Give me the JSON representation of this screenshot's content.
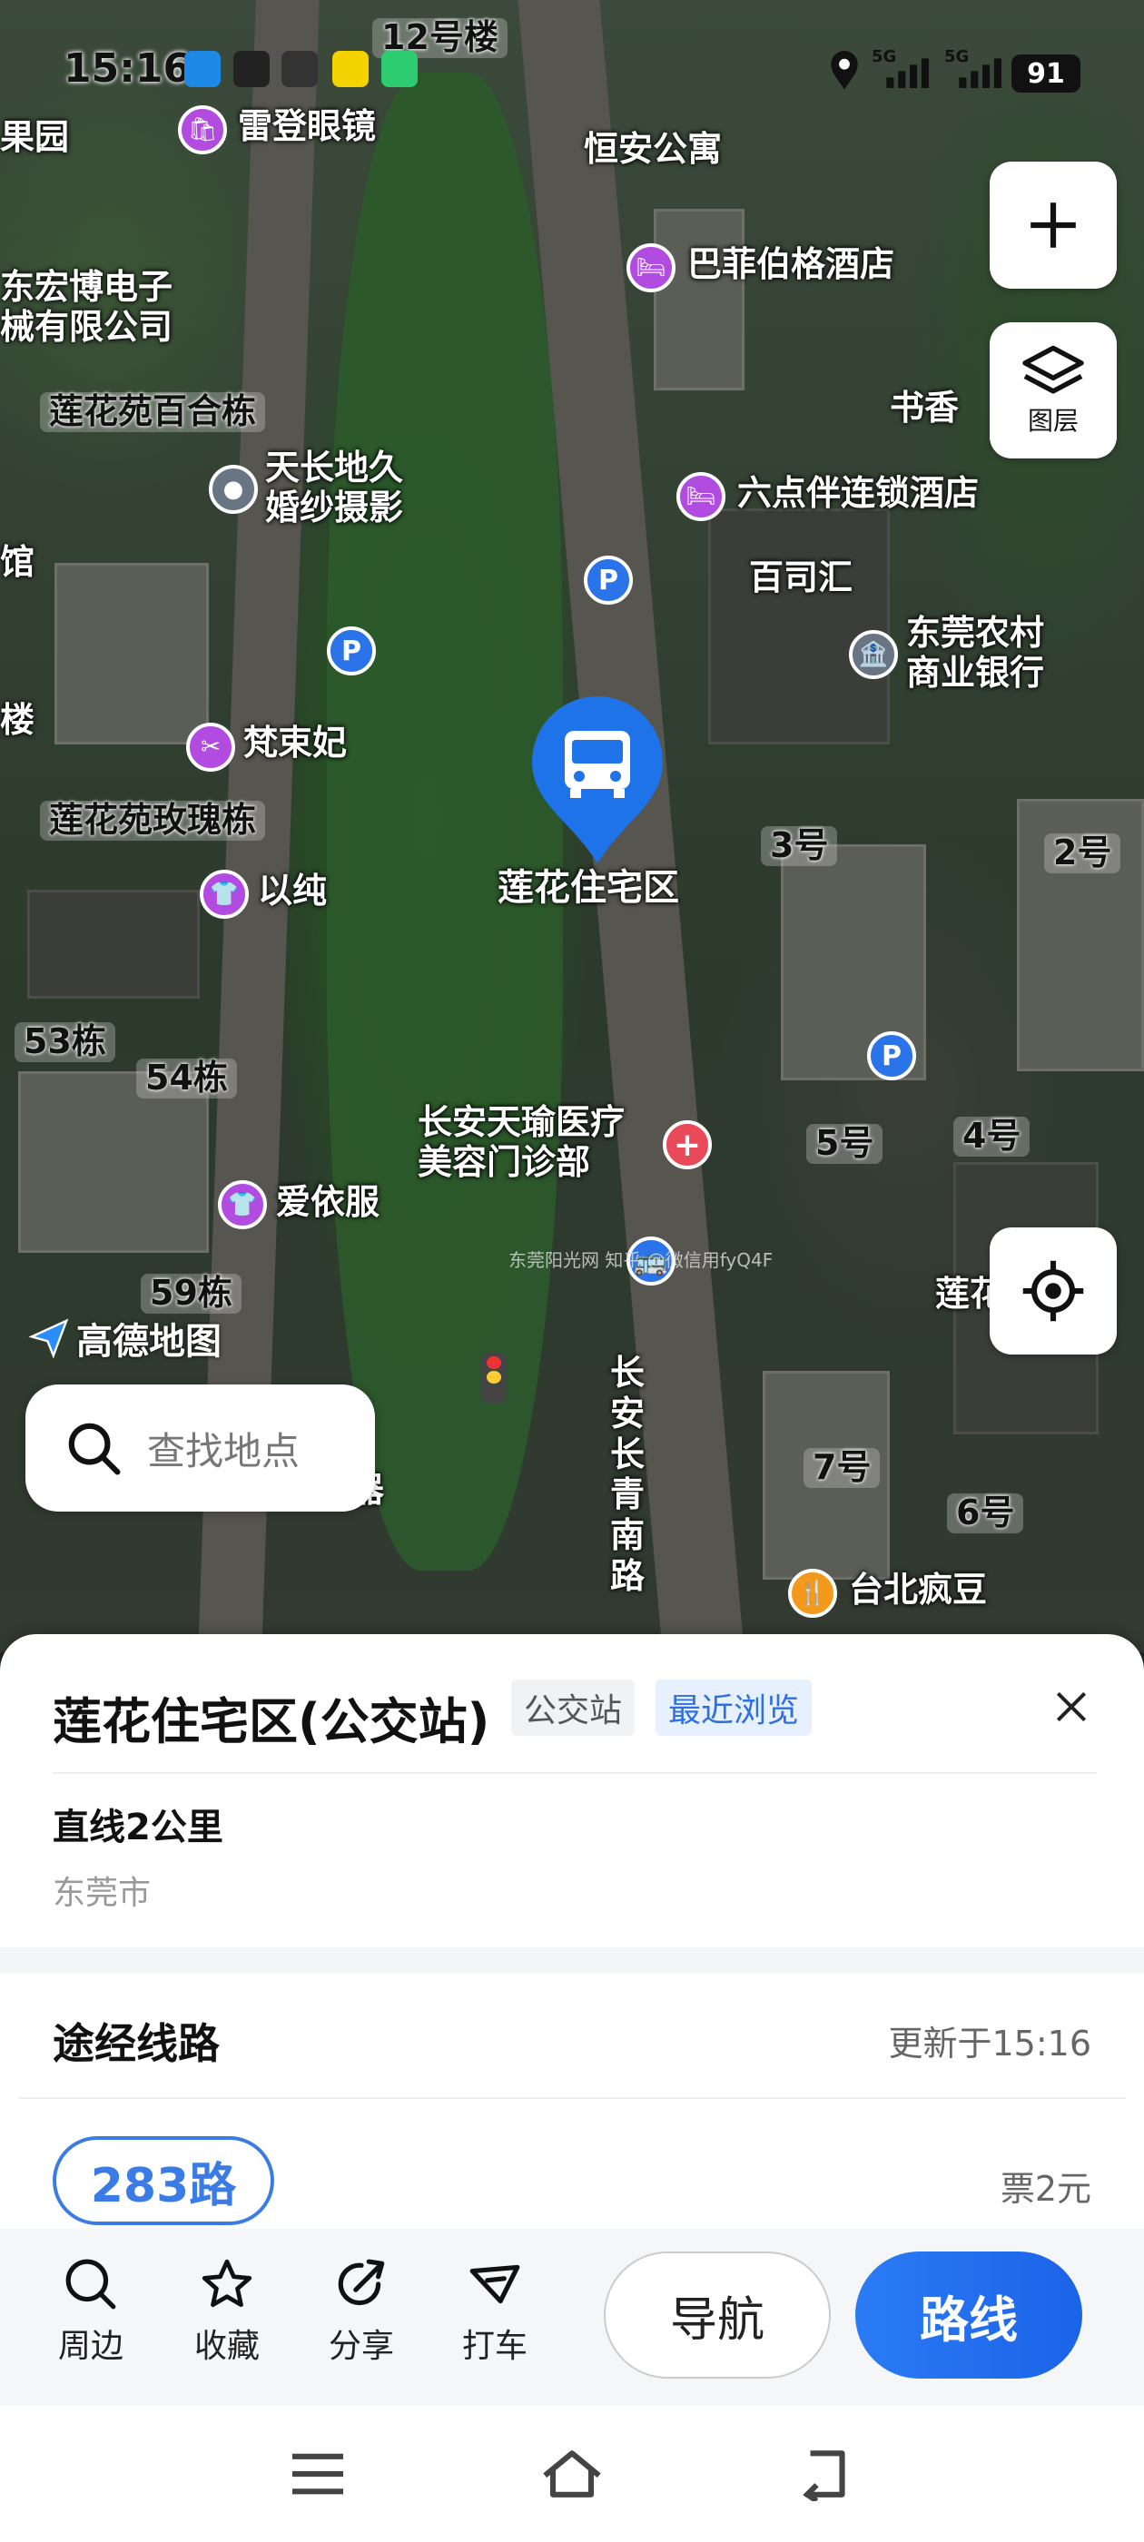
{
  "status_bar": {
    "time": "15:16",
    "battery": "91",
    "network1": "5G",
    "network2": "5G"
  },
  "map": {
    "labels": {
      "building_12": "12号楼",
      "orchard": "果园",
      "radon_glasses": "雷登眼镜",
      "hengan_apt": "恒安公寓",
      "buffet_hotel": "巴菲伯格酒店",
      "donghong": "东宏博电子\n械有限公司",
      "shuxiang": "书香",
      "lily_building": "莲花苑百合栋",
      "tianchang": "天长地久\n婚纱摄影",
      "liudianban": "六点伴连锁酒店",
      "guan": "馆",
      "baisihui": "百司汇",
      "rcb": "东莞农村\n商业银行",
      "lou": "楼",
      "fanshufei": "梵束妃",
      "rose_building": "莲花苑玫瑰栋",
      "no3": "3号",
      "no2": "2号",
      "yichun": "以纯",
      "b53": "53栋",
      "b54": "54栋",
      "clinic": "长安天瑜医疗\n美容门诊部",
      "no5": "5号",
      "no4": "4号",
      "aiyifu": "爱依服",
      "b59": "59栋",
      "lianhua_right": "莲花",
      "road": "长\n安\n长\n青\n南\n路",
      "no7": "7号",
      "no6": "6号",
      "taipei": "台北疯豆",
      "qi": "器"
    },
    "selected_stop": "莲花住宅区",
    "layer_button_label": "图层",
    "search_placeholder": "查找地点",
    "logo": "高德地图",
    "watermark": "东莞阳光网 知乎 @微信用fyQ4F"
  },
  "sheet": {
    "title": "莲花住宅区(公交站)",
    "tag_type": "公交站",
    "tag_recent": "最近浏览",
    "distance": "直线2公里",
    "city": "东莞市",
    "routes_title": "途经线路",
    "updated": "更新于15:16",
    "route_name": "283路",
    "fare": "票2元"
  },
  "actions": {
    "nearby": "周边",
    "favorite": "收藏",
    "share": "分享",
    "taxi": "打车",
    "navigate": "导航",
    "route": "路线"
  },
  "colors": {
    "accent": "#2b7bf5",
    "route_chip": "#3a7be6",
    "poi_purple": "#b24be0",
    "parking_blue": "#2a73e8"
  }
}
